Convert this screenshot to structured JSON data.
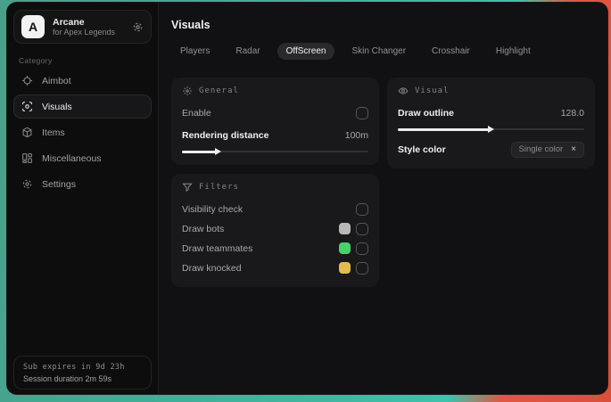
{
  "sidebar": {
    "logo": {
      "letter": "A",
      "title": "Arcane",
      "subtitle": "for Apex Legends"
    },
    "category_label": "Category",
    "items": [
      {
        "label": "Aimbot"
      },
      {
        "label": "Visuals",
        "selected": true
      },
      {
        "label": "Items"
      },
      {
        "label": "Miscellaneous"
      },
      {
        "label": "Settings"
      }
    ],
    "footer": {
      "line1": "Sub expires in 9d 23h",
      "line2": "Session duration 2m 59s"
    }
  },
  "header": {
    "title": "Visuals"
  },
  "tabs": [
    {
      "label": "Players"
    },
    {
      "label": "Radar"
    },
    {
      "label": "OffScreen",
      "selected": true
    },
    {
      "label": "Skin Changer"
    },
    {
      "label": "Crosshair"
    },
    {
      "label": "Highlight"
    }
  ],
  "panels": {
    "general": {
      "title": "General",
      "enable_label": "Enable",
      "rendering": {
        "label": "Rendering distance",
        "value": "100m",
        "percent": 18
      }
    },
    "filters": {
      "title": "Filters",
      "rows": [
        {
          "label": "Visibility check"
        },
        {
          "label": "Draw bots",
          "swatch": "#b9b9ba"
        },
        {
          "label": "Draw teammates",
          "swatch": "#47d16b"
        },
        {
          "label": "Draw knocked",
          "swatch": "#e2bd4e"
        }
      ]
    },
    "visual": {
      "title": "Visual",
      "outline": {
        "label": "Draw outline",
        "value": "128.0",
        "percent": 49
      },
      "style_color": {
        "label": "Style color",
        "tag": "Single color",
        "close": "×"
      }
    }
  }
}
